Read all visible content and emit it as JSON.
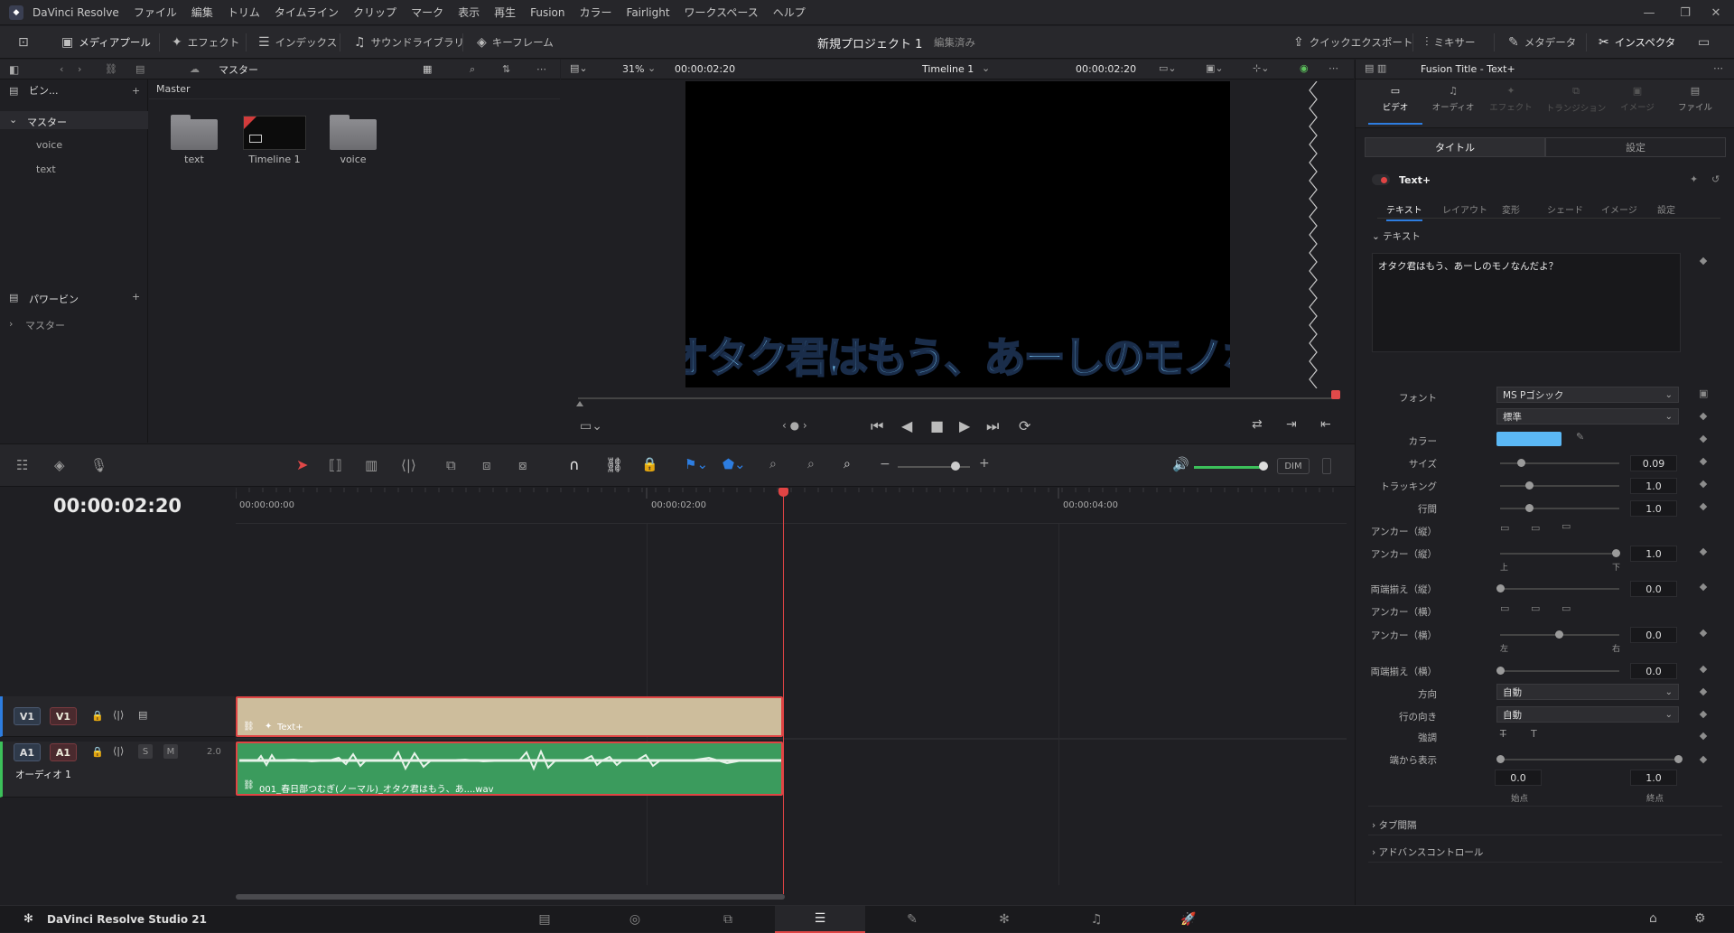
{
  "menubar": {
    "app_name": "DaVinci Resolve",
    "items": [
      "ファイル",
      "編集",
      "トリム",
      "タイムライン",
      "クリップ",
      "マーク",
      "表示",
      "再生",
      "Fusion",
      "カラー",
      "Fairlight",
      "ワークスペース",
      "ヘルプ"
    ]
  },
  "toolbar": {
    "media_pool": "メディアプール",
    "effects": "エフェクト",
    "index": "インデックス",
    "sound_library": "サウンドライブラリ",
    "keyframe": "キーフレーム",
    "project_title": "新規プロジェクト 1",
    "project_status": "編集済み",
    "quick_export": "クイックエクスポート",
    "mixer": "ミキサー",
    "metadata": "メタデータ",
    "inspector": "インスペクタ"
  },
  "media_pool": {
    "header_path": "マスター",
    "master_label": "Master",
    "bins_title": "ビン...",
    "tree_root": "マスター",
    "tree_children": [
      "voice",
      "text"
    ],
    "power_bins_title": "パワービン",
    "power_bins_root": "マスター",
    "items": [
      {
        "label": "text",
        "kind": "folder"
      },
      {
        "label": "Timeline 1",
        "kind": "timeline"
      },
      {
        "label": "voice",
        "kind": "folder"
      }
    ]
  },
  "viewer": {
    "zoom": "31%",
    "timecode_left": "00:00:02:20",
    "timeline_name": "Timeline 1",
    "timecode_right": "00:00:02:20",
    "overlay_text": "オタク君はもう、あーしのモノなんだよ？"
  },
  "timeline": {
    "current_timecode": "00:00:02:20",
    "ruler": [
      "00:00:00:00",
      "00:00:02:00",
      "00:00:04:00"
    ],
    "dim_label": "DIM",
    "video_track": {
      "chip1": "V1",
      "chip2": "V1",
      "clip_label": "Text+"
    },
    "audio_track": {
      "chip1": "A1",
      "chip2": "A1",
      "solo": "S",
      "mute": "M",
      "level": "2.0",
      "name": "オーディオ 1",
      "clip_label": "001_春日部つむぎ(ノーマル)_オタク君はもう、あ....wav"
    }
  },
  "inspector": {
    "title": "Fusion Title - Text+",
    "top_tabs": [
      "ビデオ",
      "オーディオ",
      "エフェクト",
      "トランジション",
      "イメージ",
      "ファイル"
    ],
    "sub_tabs": [
      "タイトル",
      "設定"
    ],
    "node_name": "Text+",
    "inner_tabs": [
      "テキスト",
      "レイアウト",
      "変形",
      "シェード",
      "イメージ",
      "設定"
    ],
    "section_text": "テキスト",
    "text_value": "オタク君はもう、あーしのモノなんだよ？",
    "font_label": "フォント",
    "font_value": "MS Pゴシック",
    "style_value": "標準",
    "color_label": "カラー",
    "color_value": "#5bb8f5",
    "size_label": "サイズ",
    "size_value": "0.09",
    "tracking_label": "トラッキング",
    "tracking_value": "1.0",
    "linespacing_label": "行間",
    "linespacing_value": "1.0",
    "anchor_v_label": "アンカー（縦）",
    "anchor_v2_label": "アンカー（縦）",
    "anchor_v_value": "1.0",
    "anchor_v_min": "上",
    "anchor_v_max": "下",
    "justify_v_label": "両端揃え（縦）",
    "justify_v_value": "0.0",
    "anchor_h_label": "アンカー（横）",
    "anchor_h2_label": "アンカー（横）",
    "anchor_h_value": "0.0",
    "anchor_h_min": "左",
    "anchor_h_max": "右",
    "justify_h_label": "両端揃え（横）",
    "justify_h_value": "0.0",
    "direction_label": "方向",
    "direction_value": "自動",
    "line_dir_label": "行の向き",
    "line_dir_value": "自動",
    "emphasis_label": "強調",
    "write_on_label": "端から表示",
    "write_on_start": "0.0",
    "write_on_end": "1.0",
    "start_label": "始点",
    "end_label": "終点",
    "tab_spacing": "タブ間隔",
    "advanced_controls": "アドバンスコントロール"
  },
  "footer": {
    "product": "DaVinci Resolve Studio 21"
  }
}
